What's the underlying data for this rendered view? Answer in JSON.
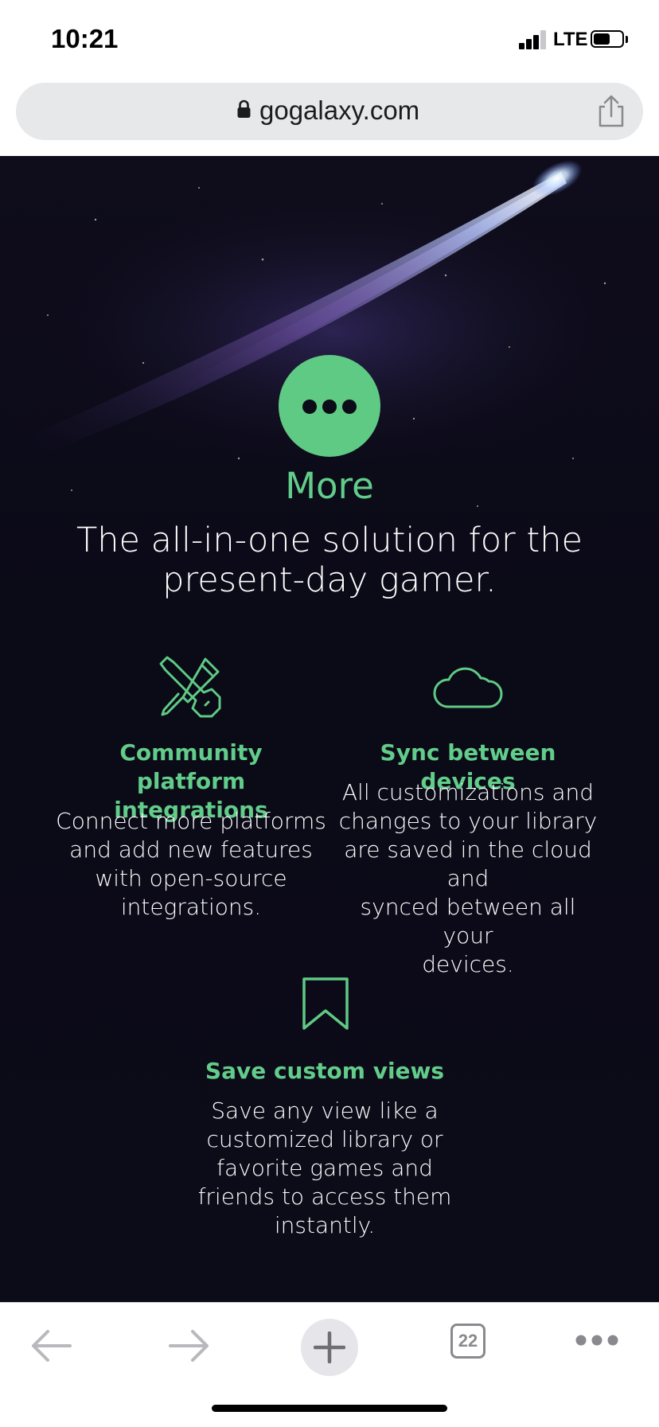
{
  "status_bar": {
    "time": "10:21",
    "network": "LTE",
    "icons": [
      "signal-icon",
      "battery-icon"
    ]
  },
  "address_bar": {
    "url": "gogalaxy.com",
    "icons": [
      "lock-icon",
      "share-icon"
    ]
  },
  "hero": {
    "badge_icon": "more-dots-icon",
    "title": "More",
    "subtitle_line1": "The all-in-one solution for the",
    "subtitle_line2": "present-day gamer."
  },
  "features": [
    {
      "icon": "tools-icon",
      "title_lines": [
        "Community platform",
        "integrations"
      ],
      "desc_lines": [
        "Connect more platforms",
        "and add new features",
        "with open-source",
        "integrations."
      ]
    },
    {
      "icon": "cloud-icon",
      "title_lines": [
        "Sync between devices"
      ],
      "desc_lines": [
        "All customizations and",
        "changes to your library",
        "are saved in the cloud and",
        "synced between all your",
        "devices."
      ]
    },
    {
      "icon": "bookmark-icon",
      "title_lines": [
        "Save custom views"
      ],
      "desc_lines": [
        "Save any view like a",
        "customized library or",
        "favorite games and",
        "friends to access them",
        "instantly."
      ]
    }
  ],
  "toolbar": {
    "tabs_count": "22",
    "icons": [
      "back-arrow-icon",
      "forward-arrow-icon",
      "plus-icon",
      "tabs-icon",
      "more-menu-icon"
    ]
  },
  "colors": {
    "accent_green": "#62cc8a",
    "background_dark": "#0c0b18",
    "toolbar_gray": "#8a8a8e"
  }
}
